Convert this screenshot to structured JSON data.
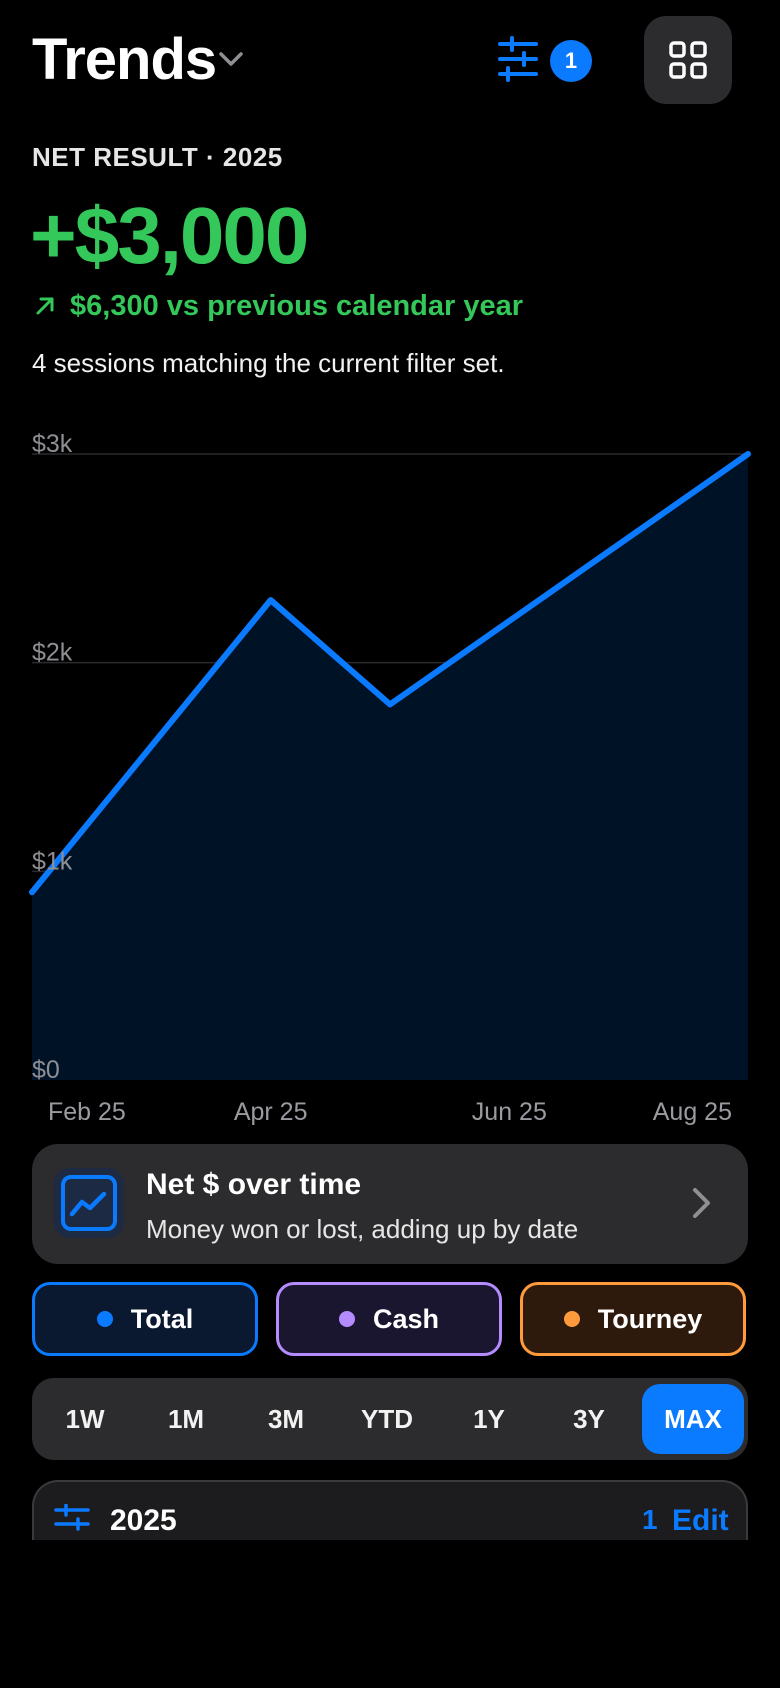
{
  "header": {
    "title": "Trends",
    "filter_count": "1",
    "icons": [
      "chevron-down-icon",
      "sliders-icon",
      "grid-icon"
    ]
  },
  "summary": {
    "label": "NET RESULT · 2025",
    "value": "+$3,000",
    "delta": "$6,300 vs previous calendar year",
    "sessions_text": "4 sessions matching the current filter set."
  },
  "chart_data": {
    "type": "area",
    "x": [
      "Feb 25",
      "Apr 25",
      "May 25",
      "Aug 25"
    ],
    "y": [
      900,
      2300,
      1800,
      3000
    ],
    "x_tick_labels": [
      "Feb 25",
      "Apr 25",
      "Jun 25",
      "Aug 25"
    ],
    "y_tick_labels": [
      "$3k",
      "$2k",
      "$1k",
      "$0"
    ],
    "ylim": [
      0,
      3000
    ],
    "grid": true,
    "line_color": "#0a7aff",
    "fill_color": "#001226"
  },
  "metric": {
    "title": "Net $ over time",
    "subtitle": "Money won or lost, adding up by date"
  },
  "series_toggles": [
    {
      "label": "Total",
      "color": "#0a7aff"
    },
    {
      "label": "Cash",
      "color": "#b48cff"
    },
    {
      "label": "Tourney",
      "color": "#ff9a3d"
    }
  ],
  "ranges": {
    "options": [
      "1W",
      "1M",
      "3M",
      "YTD",
      "1Y",
      "3Y",
      "MAX"
    ],
    "selected": "MAX"
  },
  "filter_card": {
    "title": "2025",
    "count": "1",
    "edit_label": "Edit"
  },
  "colors": {
    "positive": "#34c759",
    "accent": "#0a7aff",
    "card": "#2c2c2e"
  }
}
